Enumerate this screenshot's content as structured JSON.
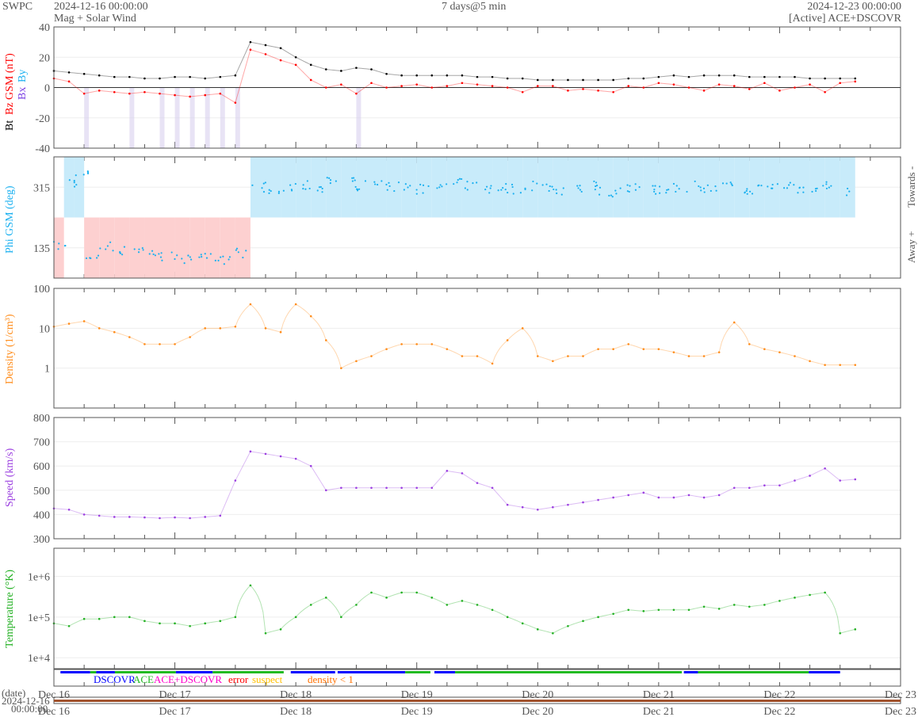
{
  "header": {
    "org": "SWPC",
    "start": "2024-12-16 00:00:00",
    "subtitle": "Mag + Solar Wind",
    "span": "7 days@5 min",
    "end": "2024-12-23 00:00:00",
    "source": "[Active] ACE+DSCOVR"
  },
  "colors": {
    "bt": "#000000",
    "bz": "#ff0000",
    "bx": "#7b3fe4",
    "by": "#1ab0f0",
    "phi": "#1ab0f0",
    "density": "#ff8c1a",
    "speed": "#9b3fe0",
    "temp": "#22b022",
    "dscovr": "#0000ff",
    "ace": "#22bb22",
    "both": "#ff00cc",
    "error": "#ff0000",
    "suspect": "#ffc000",
    "lowdens": "#ff7000"
  },
  "legend": {
    "dscovr": "DSCOVR",
    "ace": "ACE",
    "both": "ACE+DSCOVR",
    "error": "error",
    "suspect": "suspect",
    "lowdens": "density < 1"
  },
  "xaxis": {
    "date_label": "(date)",
    "slider_date": "2024-12-16",
    "slider_time": "00:00:00",
    "ticks": [
      "Dec 16",
      "Dec 17",
      "Dec 18",
      "Dec 19",
      "Dec 20",
      "Dec 21",
      "Dec 22",
      "Dec 23"
    ],
    "range_hours": [
      0,
      168
    ]
  },
  "chart_data": [
    {
      "type": "line",
      "name": "mag",
      "ylabel_bt": "Bt",
      "ylabel_bz": "Bz GSM (nT)",
      "ylabel_bx": "Bx",
      "ylabel_by": "By",
      "ylim": [
        -40,
        40
      ],
      "yticks": [
        "40",
        "20",
        "0",
        "-20",
        "-40"
      ],
      "ytick_values": [
        40,
        20,
        0,
        -20,
        -40
      ],
      "x": [
        0,
        3,
        6,
        9,
        12,
        15,
        18,
        21,
        24,
        27,
        30,
        33,
        36,
        39,
        42,
        45,
        48,
        51,
        54,
        57,
        60,
        63,
        66,
        69,
        72,
        75,
        78,
        81,
        84,
        87,
        90,
        93,
        96,
        99,
        102,
        105,
        108,
        111,
        114,
        117,
        120,
        123,
        126,
        129,
        132,
        135,
        138,
        141,
        144,
        147,
        150,
        153,
        156,
        159
      ],
      "series": [
        {
          "name": "Bt",
          "values": [
            11,
            10,
            9,
            8,
            7,
            7,
            6,
            6,
            7,
            7,
            6,
            7,
            8,
            30,
            28,
            26,
            20,
            15,
            12,
            11,
            13,
            12,
            9,
            8,
            8,
            8,
            8,
            8,
            7,
            7,
            6,
            6,
            5,
            5,
            5,
            5,
            5,
            5,
            6,
            6,
            7,
            8,
            7,
            8,
            8,
            8,
            7,
            7,
            7,
            7,
            6,
            6,
            6,
            6
          ]
        },
        {
          "name": "Bz",
          "values": [
            6,
            4,
            -4,
            -2,
            -3,
            -4,
            -3,
            -4,
            -5,
            -6,
            -5,
            -4,
            -10,
            25,
            22,
            18,
            15,
            5,
            0,
            2,
            -4,
            3,
            0,
            1,
            2,
            0,
            1,
            3,
            2,
            1,
            0,
            -3,
            1,
            1,
            -2,
            -1,
            -2,
            -3,
            1,
            0,
            3,
            2,
            0,
            -2,
            2,
            1,
            -1,
            3,
            -2,
            0,
            2,
            -3,
            3,
            4
          ]
        }
      ]
    },
    {
      "type": "scatter",
      "name": "phi",
      "ylabel": "Phi GSM (deg)",
      "right_top": "Towards -",
      "right_bottom": "Away +",
      "ylim": [
        45,
        405
      ],
      "yticks": [
        "315",
        "135"
      ],
      "ytick_values": [
        315,
        135
      ],
      "x": [
        0,
        2,
        4,
        6,
        9,
        12,
        15,
        18,
        21,
        24,
        27,
        30,
        33,
        36,
        39,
        42,
        45,
        48,
        51,
        54,
        57,
        60,
        63,
        66,
        69,
        72,
        75,
        78,
        81,
        84,
        87,
        90,
        93,
        96,
        99,
        102,
        105,
        108,
        111,
        114,
        117,
        120,
        123,
        126,
        129,
        132,
        135,
        138,
        141,
        144,
        147,
        150,
        153,
        156,
        159
      ],
      "values": [
        140,
        330,
        350,
        110,
        140,
        125,
        130,
        120,
        110,
        100,
        115,
        105,
        95,
        120,
        315,
        300,
        310,
        320,
        315,
        335,
        330,
        320,
        325,
        315,
        320,
        310,
        315,
        325,
        320,
        310,
        315,
        310,
        320,
        315,
        305,
        315,
        320,
        300,
        310,
        315,
        305,
        310,
        315,
        320,
        310,
        315,
        305,
        310,
        315,
        320,
        310,
        315,
        320,
        300,
        340
      ]
    },
    {
      "type": "line",
      "name": "density",
      "ylabel": "Density (1/cm³)",
      "scale": "log",
      "ylim": [
        0.1,
        100
      ],
      "yticks": [
        "100",
        "10",
        "1"
      ],
      "ytick_values": [
        100,
        10,
        1
      ],
      "x": [
        0,
        3,
        6,
        9,
        12,
        15,
        18,
        21,
        24,
        27,
        30,
        33,
        36,
        39,
        42,
        45,
        48,
        51,
        54,
        57,
        60,
        63,
        66,
        69,
        72,
        75,
        78,
        81,
        84,
        87,
        90,
        93,
        96,
        99,
        102,
        105,
        108,
        111,
        114,
        117,
        120,
        123,
        126,
        129,
        132,
        135,
        138,
        141,
        144,
        147,
        150,
        153,
        156,
        159
      ],
      "values": [
        11,
        13,
        15,
        10,
        8,
        6,
        4,
        4,
        4,
        6,
        10,
        10,
        11,
        40,
        10,
        8,
        40,
        20,
        5,
        1,
        1.5,
        2,
        3,
        4,
        4,
        4,
        3,
        2,
        2,
        1.3,
        5,
        10,
        2,
        1.5,
        2,
        2,
        3,
        3,
        4,
        3,
        3,
        2.5,
        2,
        2,
        2.5,
        14,
        4,
        3,
        2.5,
        2,
        1.5,
        1.2,
        1.2,
        1.2
      ]
    },
    {
      "type": "line",
      "name": "speed",
      "ylabel": "Speed (km/s)",
      "ylim": [
        300,
        800
      ],
      "yticks": [
        "800",
        "700",
        "600",
        "500",
        "400",
        "300"
      ],
      "ytick_values": [
        800,
        700,
        600,
        500,
        400,
        300
      ],
      "x": [
        0,
        3,
        6,
        9,
        12,
        15,
        18,
        21,
        24,
        27,
        30,
        33,
        36,
        39,
        42,
        45,
        48,
        51,
        54,
        57,
        60,
        63,
        66,
        69,
        72,
        75,
        78,
        81,
        84,
        87,
        90,
        93,
        96,
        99,
        102,
        105,
        108,
        111,
        114,
        117,
        120,
        123,
        126,
        129,
        132,
        135,
        138,
        141,
        144,
        147,
        150,
        153,
        156,
        159
      ],
      "values": [
        425,
        420,
        400,
        395,
        390,
        390,
        388,
        385,
        388,
        385,
        390,
        395,
        540,
        660,
        650,
        640,
        630,
        600,
        500,
        510,
        510,
        510,
        510,
        510,
        510,
        510,
        580,
        570,
        530,
        510,
        440,
        430,
        420,
        430,
        440,
        450,
        460,
        470,
        480,
        490,
        470,
        470,
        480,
        470,
        480,
        510,
        510,
        520,
        520,
        540,
        560,
        590,
        540,
        545
      ]
    },
    {
      "type": "line",
      "name": "temperature",
      "ylabel": "Temperature (°K)",
      "scale": "log",
      "ylim": [
        5400,
        4900000
      ],
      "yticks": [
        "1e+6",
        "1e+5",
        "1e+4"
      ],
      "ytick_values": [
        1000000,
        100000,
        10000
      ],
      "x": [
        0,
        3,
        6,
        9,
        12,
        15,
        18,
        21,
        24,
        27,
        30,
        33,
        36,
        39,
        42,
        45,
        48,
        51,
        54,
        57,
        60,
        63,
        66,
        69,
        72,
        75,
        78,
        81,
        84,
        87,
        90,
        93,
        96,
        99,
        102,
        105,
        108,
        111,
        114,
        117,
        120,
        123,
        126,
        129,
        132,
        135,
        138,
        141,
        144,
        147,
        150,
        153,
        156,
        159
      ],
      "values": [
        70000,
        60000,
        90000,
        90000,
        100000,
        100000,
        80000,
        70000,
        70000,
        60000,
        70000,
        80000,
        100000,
        600000,
        40000,
        50000,
        100000,
        200000,
        300000,
        100000,
        200000,
        400000,
        300000,
        400000,
        400000,
        300000,
        200000,
        250000,
        200000,
        150000,
        100000,
        70000,
        50000,
        40000,
        60000,
        80000,
        100000,
        120000,
        150000,
        140000,
        150000,
        150000,
        150000,
        180000,
        160000,
        200000,
        180000,
        200000,
        250000,
        300000,
        350000,
        400000,
        40000,
        50000
      ]
    },
    {
      "type": "table",
      "name": "source",
      "segments": [
        [
          1.3,
          7.2,
          "dscovr"
        ],
        [
          7.2,
          8.4,
          "ace"
        ],
        [
          8.4,
          12.1,
          "dscovr"
        ],
        [
          12.1,
          24.2,
          "ace"
        ],
        [
          24.2,
          31.5,
          "dscovr"
        ],
        [
          31.5,
          45.6,
          "ace"
        ],
        [
          47,
          55.8,
          "dscovr"
        ],
        [
          56.3,
          69.7,
          "dscovr"
        ],
        [
          69.7,
          74.7,
          "ace"
        ],
        [
          75.5,
          79.6,
          "dscovr"
        ],
        [
          79.6,
          124.6,
          "ace"
        ],
        [
          125,
          127.8,
          "dscovr"
        ],
        [
          127.8,
          149.8,
          "ace"
        ],
        [
          149.8,
          156,
          "dscovr"
        ]
      ]
    }
  ]
}
